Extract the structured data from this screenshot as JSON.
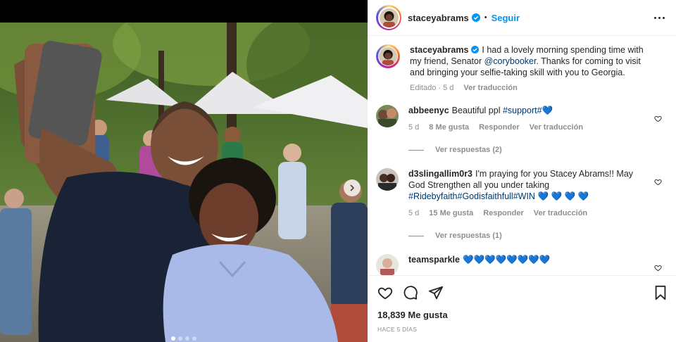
{
  "post": {
    "author": "staceyabrams",
    "follow_label": "Seguir",
    "separator": "•",
    "caption_text": "I had a lovely morning spending time with my friend, Senator ",
    "caption_mention": "@corybooker",
    "caption_rest": ". Thanks for coming to visit and bringing your selfie-taking skill with you to Georgia.",
    "edited_label": "Editado · 5 d",
    "translate_label": "Ver traducción",
    "likes_text": "18,839 Me gusta",
    "time_ago": "HACE 5 DÍAS"
  },
  "comments": [
    {
      "user": "abbeenyc",
      "text": "Beautiful ppl ",
      "tag": "#support#",
      "emoji": "💙",
      "age": "5 d",
      "likes": "8 Me gusta",
      "reply_label": "Responder",
      "translate_label": "Ver traducción",
      "view_replies": "Ver respuestas (2)"
    },
    {
      "user": "d3slingallim0r3",
      "text": "I'm praying for you Stacey Abrams!! May God Strengthen all you under taking ",
      "tag": "#Ridebyfaith#Godisfaithfull#WIN",
      "emoji": "💙 💙 💙 💙",
      "age": "5 d",
      "likes": "15 Me gusta",
      "reply_label": "Responder",
      "translate_label": "Ver traducción",
      "view_replies": "Ver respuestas (1)"
    },
    {
      "user": "teamsparkle",
      "text": "",
      "tag": "",
      "emoji": "💙💙💙💙💙💙💙💙"
    }
  ],
  "icons": {
    "like": "heart-icon",
    "comment": "comment-icon",
    "share": "share-icon",
    "save": "bookmark-icon",
    "more": "more-options-icon",
    "verified": "verified-badge-icon",
    "next": "chevron-right-icon"
  },
  "carousel": {
    "slides": 4,
    "active": 1
  },
  "colors": {
    "accent": "#0095f6",
    "link": "#00376b",
    "muted": "#8e8e8e",
    "heart_emoji": "#1d6fd1"
  }
}
